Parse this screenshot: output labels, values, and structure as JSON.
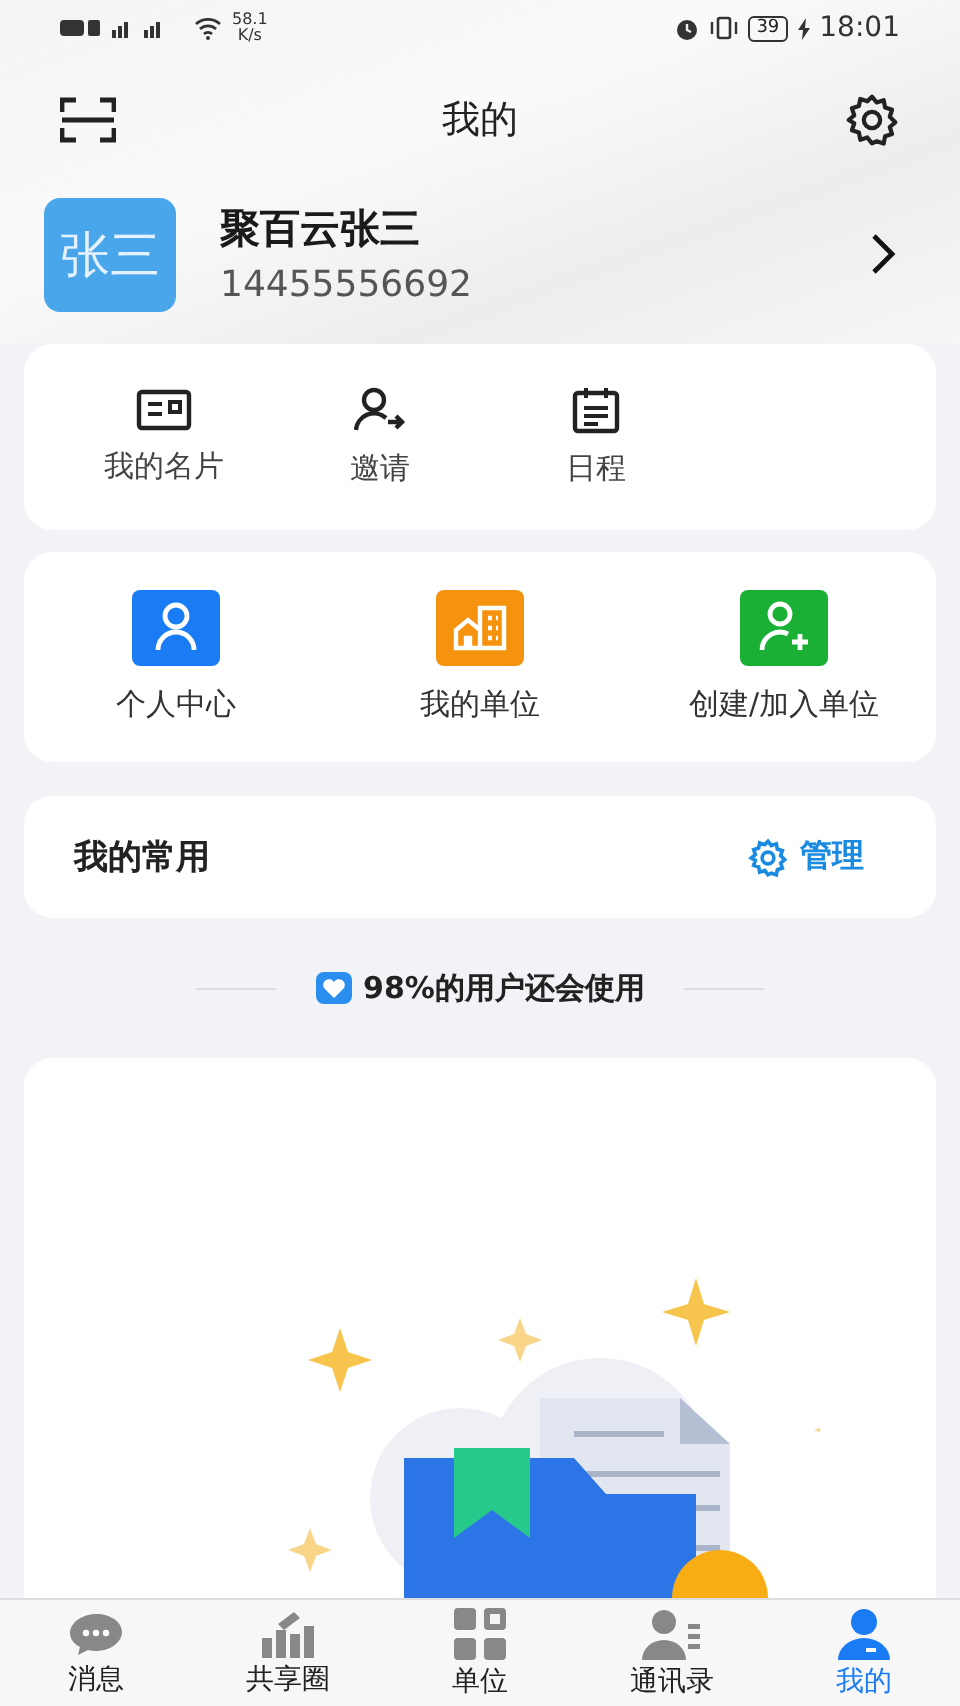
{
  "status_bar": {
    "speed": "58.1",
    "speed_unit": "K/s",
    "battery": "39",
    "time": "18:01"
  },
  "header": {
    "title": "我的"
  },
  "profile": {
    "avatar_text": "张三",
    "name": "聚百云张三",
    "phone": "14455556692"
  },
  "quick_actions": [
    {
      "kind": "card",
      "label": "我的名片"
    },
    {
      "kind": "invite",
      "label": "邀请"
    },
    {
      "kind": "calendar",
      "label": "日程"
    }
  ],
  "shortcuts": [
    {
      "kind": "person",
      "label": "个人中心",
      "color": "#1a7cf5"
    },
    {
      "kind": "building",
      "label": "我的单位",
      "color": "#f5930f"
    },
    {
      "kind": "add-person",
      "label": "创建/加入单位",
      "color": "#1ab035"
    }
  ],
  "favorites": {
    "title": "我的常用",
    "action": "管理"
  },
  "recommend": {
    "title": "98%的用户还会使用"
  },
  "tabs": [
    {
      "kind": "chat",
      "label": "消息",
      "selected": false
    },
    {
      "kind": "chart",
      "label": "共享圈",
      "selected": false
    },
    {
      "kind": "grid",
      "label": "单位",
      "selected": false
    },
    {
      "kind": "contacts",
      "label": "通讯录",
      "selected": false
    },
    {
      "kind": "me",
      "label": "我的",
      "selected": true
    }
  ]
}
